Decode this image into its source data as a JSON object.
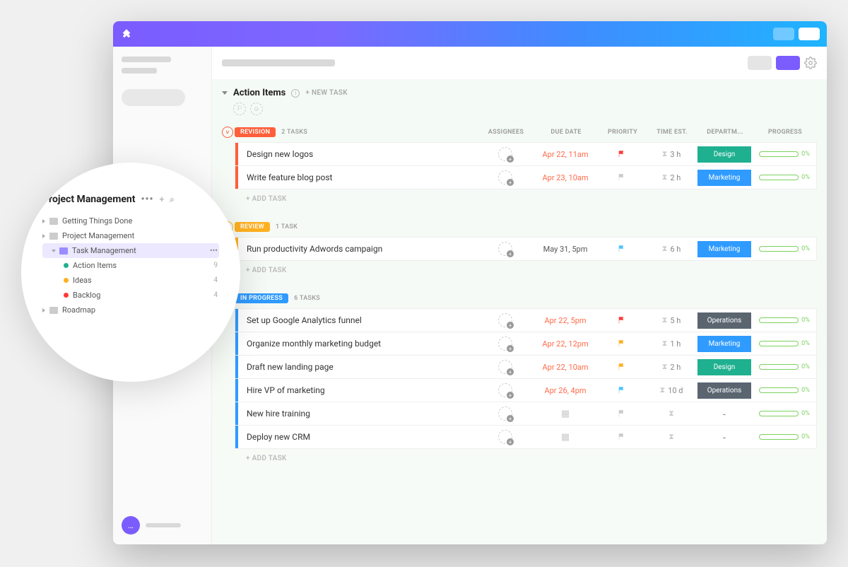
{
  "section": {
    "title": "Action Items",
    "new_task": "+ NEW TASK",
    "add_task": "+ ADD TASK"
  },
  "columns": {
    "assignees": "ASSIGNEES",
    "due_date": "DUE DATE",
    "priority": "PRIORITY",
    "time_est": "TIME EST.",
    "department": "DEPARTM...",
    "progress": "PROGRESS"
  },
  "statuses": [
    {
      "label": "REVISION",
      "color": "#ff5e3a",
      "count_label": "2 TASKS",
      "circle_color": "#ff5e3a"
    },
    {
      "label": "REVIEW",
      "color": "#ffb020",
      "count_label": "1 TASK",
      "circle_color": "#ffb020"
    },
    {
      "label": "IN PROGRESS",
      "color": "#2f9bff",
      "count_label": "6 TASKS",
      "circle_color": "#2f9bff"
    }
  ],
  "tasks": [
    [
      {
        "name": "Design new logos",
        "due": "Apr 22, 11am",
        "due_color": "#ff6b4a",
        "flag": "#ff3a3a",
        "time": "3 h",
        "dept": "Design",
        "dept_color": "#1fb090",
        "progress": "0%"
      },
      {
        "name": "Write feature blog post",
        "due": "Apr 23, 10am",
        "due_color": "#ff6b4a",
        "flag": "#c9c9c9",
        "time": "2 h",
        "dept": "Marketing",
        "dept_color": "#2f9bff",
        "progress": "0%"
      }
    ],
    [
      {
        "name": "Run productivity Adwords campaign",
        "due": "May 31, 5pm",
        "due_color": "#555",
        "flag": "#4fc3ff",
        "time": "6 h",
        "dept": "Marketing",
        "dept_color": "#2f9bff",
        "progress": "0%"
      }
    ],
    [
      {
        "name": "Set up Google Analytics funnel",
        "due": "Apr 22, 5pm",
        "due_color": "#ff6b4a",
        "flag": "#ff3a3a",
        "time": "5 h",
        "dept": "Operations",
        "dept_color": "#5a6570",
        "progress": "0%"
      },
      {
        "name": "Organize monthly marketing budget",
        "due": "Apr 22, 12pm",
        "due_color": "#ff6b4a",
        "flag": "#ffb020",
        "time": "1 h",
        "dept": "Marketing",
        "dept_color": "#2f9bff",
        "progress": "0%"
      },
      {
        "name": "Draft new landing page",
        "due": "Apr 22, 10am",
        "due_color": "#ff6b4a",
        "flag": "#ffb020",
        "time": "2 h",
        "dept": "Design",
        "dept_color": "#1fb090",
        "progress": "0%"
      },
      {
        "name": "Hire VP of marketing",
        "due": "Apr 26, 4pm",
        "due_color": "#ff6b4a",
        "flag": "#4fc3ff",
        "time": "10 d",
        "dept": "Operations",
        "dept_color": "#5a6570",
        "progress": "0%"
      },
      {
        "name": "New hire training",
        "due": "",
        "due_color": "",
        "flag": "#c9c9c9",
        "time": "",
        "dept": "-",
        "dept_color": "",
        "progress": "0%"
      },
      {
        "name": "Deploy new CRM",
        "due": "",
        "due_color": "",
        "flag": "#c9c9c9",
        "time": "",
        "dept": "-",
        "dept_color": "",
        "progress": "0%"
      }
    ]
  ],
  "sidebar": {
    "title": "Project Management",
    "items": [
      {
        "label": "Getting Things Done",
        "type": "folder"
      },
      {
        "label": "Project Management",
        "type": "folder"
      },
      {
        "label": "Task Management",
        "type": "folder-open",
        "active": true
      },
      {
        "label": "Action Items",
        "type": "list",
        "count": "9",
        "color": "#1fb090"
      },
      {
        "label": "Ideas",
        "type": "list",
        "count": "4",
        "color": "#ffb020"
      },
      {
        "label": "Backlog",
        "type": "list",
        "count": "4",
        "color": "#ff3a3a"
      },
      {
        "label": "Roadmap",
        "type": "folder"
      }
    ]
  },
  "chat_icon": "…"
}
